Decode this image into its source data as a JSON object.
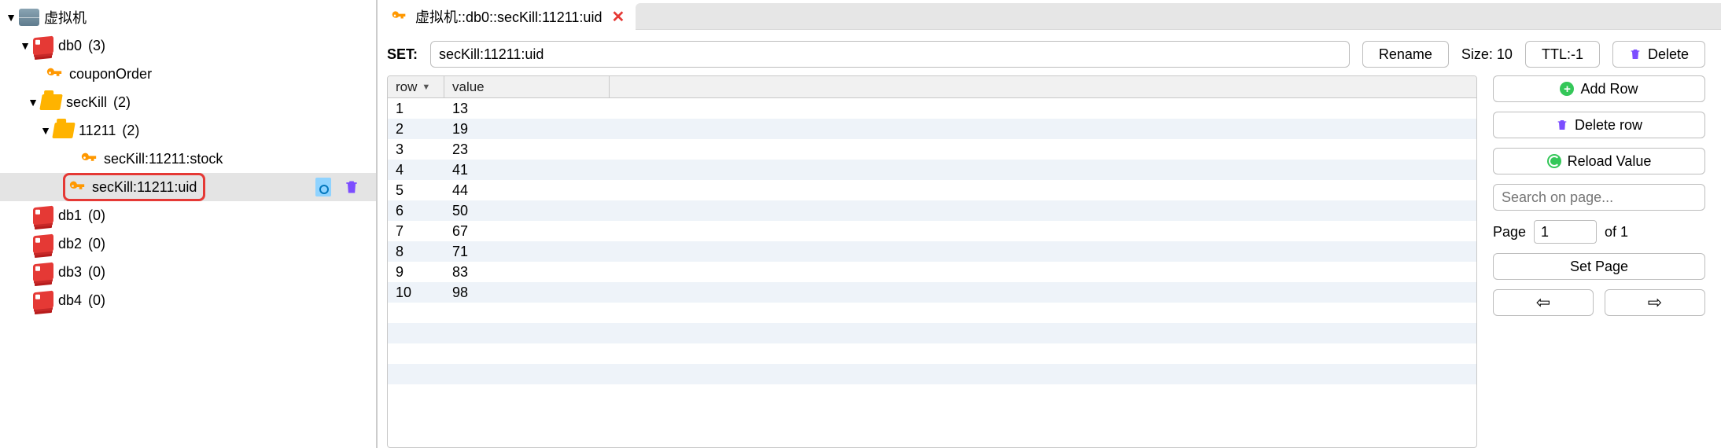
{
  "tree": {
    "server": "虚拟机",
    "db0": {
      "label": "db0",
      "count": "(3)"
    },
    "couponOrder": "couponOrder",
    "secKill": {
      "label": "secKill",
      "count": "(2)"
    },
    "k11211": {
      "label": "11211",
      "count": "(2)"
    },
    "stock": "secKill:11211:stock",
    "uid": "secKill:11211:uid",
    "db1": {
      "label": "db1",
      "count": "(0)"
    },
    "db2": {
      "label": "db2",
      "count": "(0)"
    },
    "db3": {
      "label": "db3",
      "count": "(0)"
    },
    "db4": {
      "label": "db4",
      "count": "(0)"
    }
  },
  "tab": {
    "title": "虚拟机::db0::secKill:11211:uid"
  },
  "toolbar": {
    "type_label": "SET:",
    "key_value": "secKill:11211:uid",
    "rename": "Rename",
    "size_label": "Size: 10",
    "ttl": "TTL:-1",
    "delete": "Delete"
  },
  "table": {
    "col_row": "row",
    "col_value": "value",
    "rows": [
      {
        "i": "1",
        "v": "13"
      },
      {
        "i": "2",
        "v": "19"
      },
      {
        "i": "3",
        "v": "23"
      },
      {
        "i": "4",
        "v": "41"
      },
      {
        "i": "5",
        "v": "44"
      },
      {
        "i": "6",
        "v": "50"
      },
      {
        "i": "7",
        "v": "67"
      },
      {
        "i": "8",
        "v": "71"
      },
      {
        "i": "9",
        "v": "83"
      },
      {
        "i": "10",
        "v": "98"
      }
    ]
  },
  "side": {
    "add_row": "Add Row",
    "delete_row": "Delete row",
    "reload": "Reload Value",
    "search_placeholder": "Search on page...",
    "page_label": "Page",
    "page_value": "1",
    "page_of": "of 1",
    "set_page": "Set Page",
    "prev": "⇦",
    "next": "⇨"
  }
}
